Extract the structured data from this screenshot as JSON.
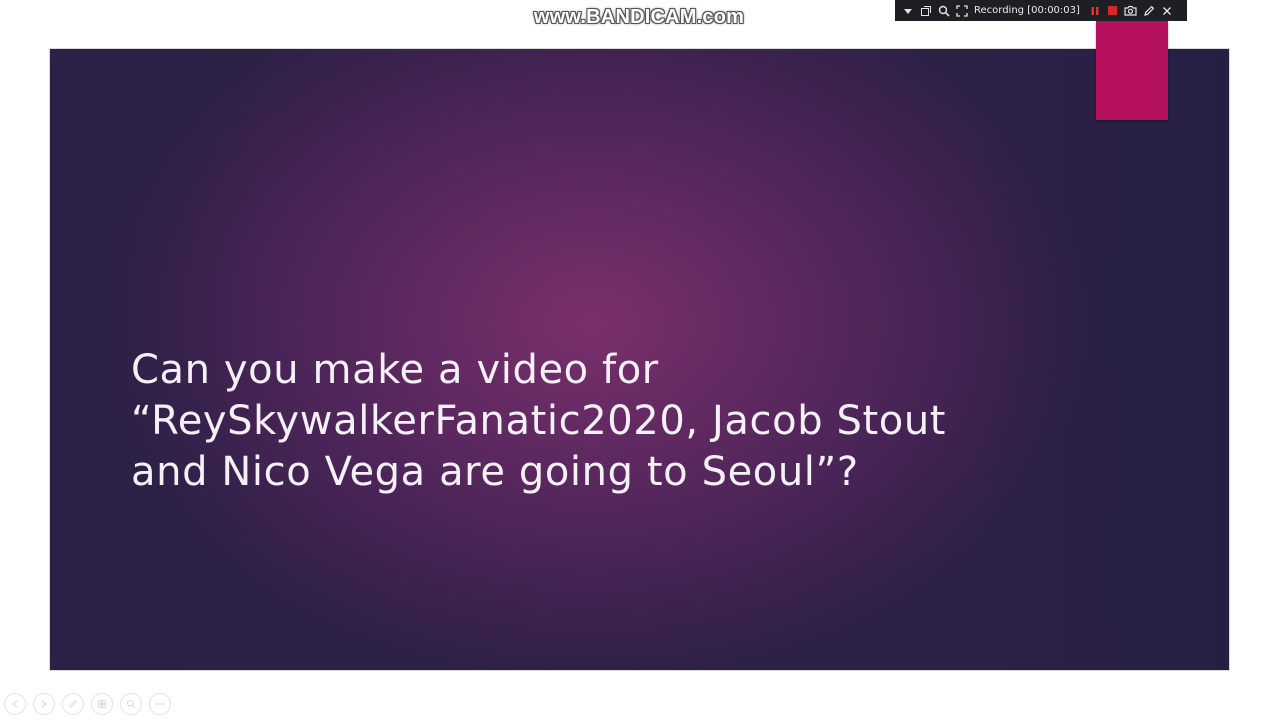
{
  "watermark": {
    "text": "www.BANDICAM.com"
  },
  "recorder": {
    "status": "Recording [00:00:03]",
    "icons": [
      "dropdown-icon",
      "window-mode-icon",
      "search-icon",
      "crop-icon",
      "pause-icon",
      "stop-icon",
      "camera-icon",
      "pencil-icon",
      "close-icon"
    ],
    "colors": {
      "background": "#1e1f24",
      "pause": "#e0342b",
      "stop": "#d9262d"
    }
  },
  "slide": {
    "title": "Can you make a video for\n“ReySkywalkerFanatic2020, Jacob Stout\nand Nico Vega are going to Seoul”?",
    "colors": {
      "background_center": "#7a2f6c",
      "background_edge": "#2d2146",
      "accent": "#b5115f",
      "text": "#f4f0f6"
    }
  },
  "slideshow_controls": {
    "icons": [
      "previous-slide-icon",
      "next-slide-icon",
      "pen-icon",
      "slides-grid-icon",
      "zoom-icon",
      "more-options-icon"
    ]
  }
}
